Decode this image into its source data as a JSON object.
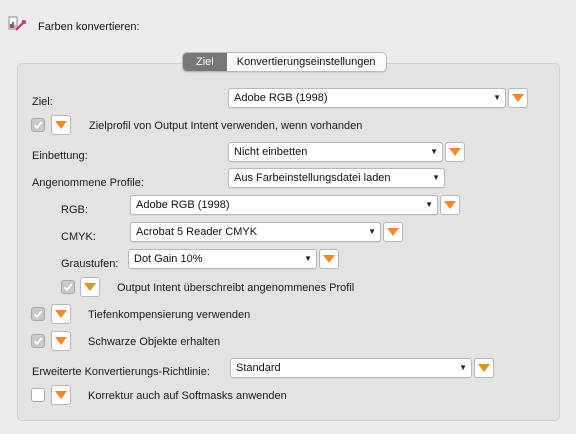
{
  "header": {
    "title": "Farben konvertieren:",
    "icon": "color-convert-icon"
  },
  "tabs": [
    {
      "label": "Ziel",
      "active": true
    },
    {
      "label": "Konvertierungseinstellungen",
      "active": false
    }
  ],
  "fields": {
    "ziel": {
      "label": "Ziel:",
      "value": "Adobe RGB (1998)"
    },
    "zielprofil": {
      "label": "Zielprofil von Output Intent verwenden, wenn vorhanden",
      "checked": true
    },
    "einbettung": {
      "label": "Einbettung:",
      "value": "Nicht einbetten"
    },
    "angenommene": {
      "label": "Angenommene Profile:",
      "value": "Aus Farbeinstellungsdatei laden"
    },
    "rgb": {
      "label": "RGB:",
      "value": "Adobe RGB (1998)"
    },
    "cmyk": {
      "label": "CMYK:",
      "value": "Acrobat 5 Reader CMYK"
    },
    "graustufen": {
      "label": "Graustufen:",
      "value": "Dot Gain 10%"
    },
    "output_intent": {
      "label": "Output Intent überschreibt angenommenes Profil",
      "checked": true
    },
    "tiefen": {
      "label": "Tiefenkompensierung verwenden",
      "checked": true
    },
    "schwarze": {
      "label": "Schwarze Objekte erhalten",
      "checked": true
    },
    "richtlinie": {
      "label": "Erweiterte Konvertierungs-Richtlinie:",
      "value": "Standard"
    },
    "korrektur": {
      "label": "Korrektur auch auf Softmasks anwenden",
      "checked": false
    }
  },
  "colors": {
    "accent": "#f08a24",
    "active_tab": "#777777"
  }
}
